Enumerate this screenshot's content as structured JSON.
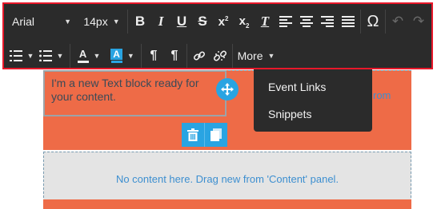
{
  "toolbar": {
    "font_family": "Arial",
    "font_size": "14px",
    "more_label": "More",
    "icons_row1": [
      "bold-icon",
      "italic-icon",
      "underline-icon",
      "strikethrough-icon",
      "superscript-icon",
      "subscript-icon",
      "clear-format-icon",
      "align-left-icon",
      "align-center-icon",
      "align-right-icon",
      "align-justify-icon",
      "special-char-icon",
      "undo-icon",
      "redo-icon"
    ],
    "icons_row2": [
      "ordered-list-icon",
      "unordered-list-icon",
      "text-color-icon",
      "background-color-icon",
      "ltr-icon",
      "rtl-icon",
      "link-icon",
      "unlink-icon"
    ]
  },
  "more_menu": {
    "items": [
      {
        "label": "Event Links"
      },
      {
        "label": "Snippets"
      }
    ]
  },
  "canvas": {
    "text_block": "I'm a new Text block ready for your content.",
    "partial_text": "rom",
    "empty_message": "No content here. Drag new from 'Content' panel."
  },
  "colors": {
    "accent": "#29a4e2",
    "block": "#ee6b47",
    "toolbar": "#2b2b2b",
    "highlight_border": "#e8182a",
    "link_text": "#3d8fd0"
  }
}
